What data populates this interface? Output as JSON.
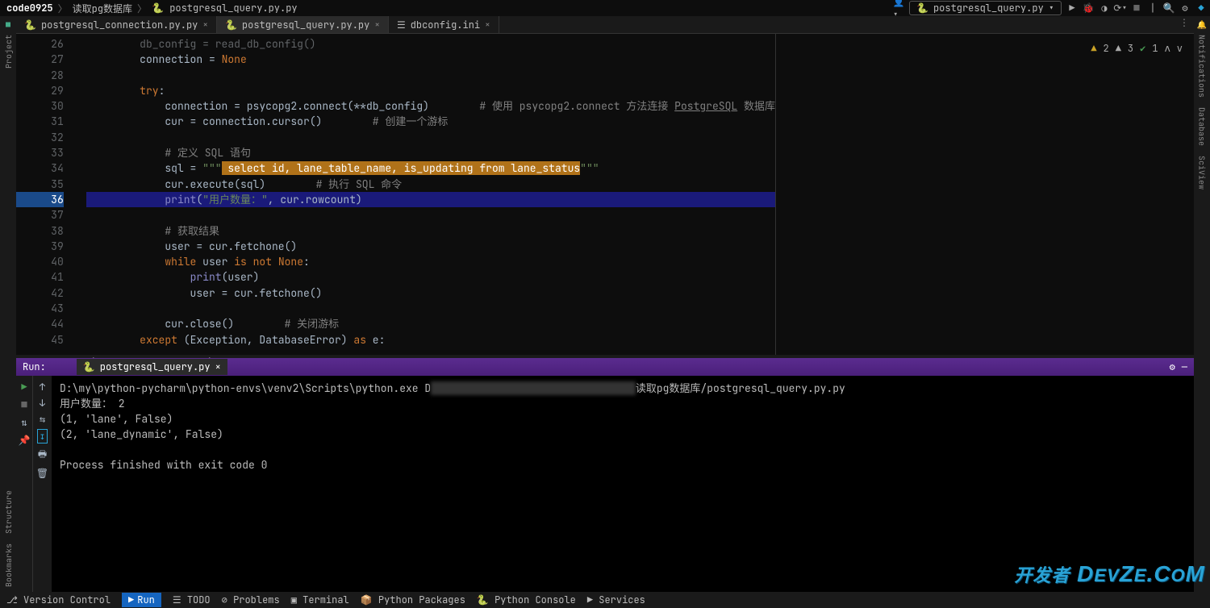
{
  "topbar": {
    "crumb1": "code0925",
    "crumb2": "读取pg数据库",
    "crumb3": "postgresql_query.py.py",
    "run_config": "postgresql_query.py"
  },
  "tabs": [
    {
      "label": "postgresql_connection.py.py",
      "active": false
    },
    {
      "label": "postgresql_query.py.py",
      "active": true
    },
    {
      "label": "dbconfig.ini",
      "active": false
    }
  ],
  "inspections": {
    "warn": "2",
    "err": "3",
    "ok": "1"
  },
  "gutter_start": 26,
  "lines": [
    {
      "n": 26,
      "html": "        db_config = read_db_config()",
      "cls": "dim"
    },
    {
      "n": 27,
      "html": "        connection = <span class='bi'>None</span>"
    },
    {
      "n": 28,
      "html": ""
    },
    {
      "n": 29,
      "html": "        <span class='kw'>try</span>:"
    },
    {
      "n": 30,
      "html": "            connection = psycopg2.connect(**db_config)        <span class='c'># 使用 psycopg2.connect 方法连接 <span class='und'>PostgreSQL</span> 数据库</span>"
    },
    {
      "n": 31,
      "html": "            cur = connection.cursor()        <span class='c'># 创建一个游标</span>"
    },
    {
      "n": 32,
      "html": ""
    },
    {
      "n": 33,
      "html": "            <span class='c'># 定义 SQL 语句</span>"
    },
    {
      "n": 34,
      "html": "            sql = <span class='s'>\"\"\"</span><span class='sel'> select id, lane_table_name, is_updating from lane_status</span><span class='s'>\"\"\"</span>"
    },
    {
      "n": 35,
      "html": "            cur.execute(sql)        <span class='c'># 执行 SQL 命令</span>"
    },
    {
      "n": 36,
      "html": "            <span class='fn'>print</span>(<span class='s'>\"用户数量：\"</span>, cur.rowcount)",
      "current": true
    },
    {
      "n": 37,
      "html": ""
    },
    {
      "n": 38,
      "html": "            <span class='c'># 获取结果</span>"
    },
    {
      "n": 39,
      "html": "            user = cur.fetchone()"
    },
    {
      "n": 40,
      "html": "            <span class='kw'>while</span> user <span class='kw'>is not</span> <span class='bi'>None</span>:"
    },
    {
      "n": 41,
      "html": "                <span class='fn'>print</span>(user)"
    },
    {
      "n": 42,
      "html": "                user = cur.fetchone()"
    },
    {
      "n": 43,
      "html": ""
    },
    {
      "n": 44,
      "html": "            cur.close()        <span class='c'># 关闭游标</span>"
    },
    {
      "n": 45,
      "html": "        <span class='kw'>except</span> (<span class='id'>Exception</span>, DatabaseError) <span class='kw'>as</span> e:"
    }
  ],
  "breadcrumb2": {
    "a": "if __name__ == '__main__'",
    "b": "try"
  },
  "run": {
    "title": "Run:",
    "tab": "postgresql_query.py",
    "console": [
      "D:\\my\\python-pycharm\\python-envs\\venv2\\Scripts\\python.exe D███████████████████████████████████读取pg数据库/postgresql_query.py.py",
      "用户数量： 2",
      "(1, 'lane', False)",
      "(2, 'lane_dynamic', False)",
      "",
      "Process finished with exit code 0"
    ]
  },
  "bottombar": {
    "items": [
      "Version Control",
      "Run",
      "TODO",
      "Problems",
      "Terminal",
      "Python Packages",
      "Python Console",
      "Services"
    ]
  },
  "leftrail": [
    "Project",
    "Structure",
    "Bookmarks"
  ],
  "rightrail": [
    "Notifications",
    "Database",
    "SciView"
  ],
  "watermark": "开发者 DevZe.CoM"
}
